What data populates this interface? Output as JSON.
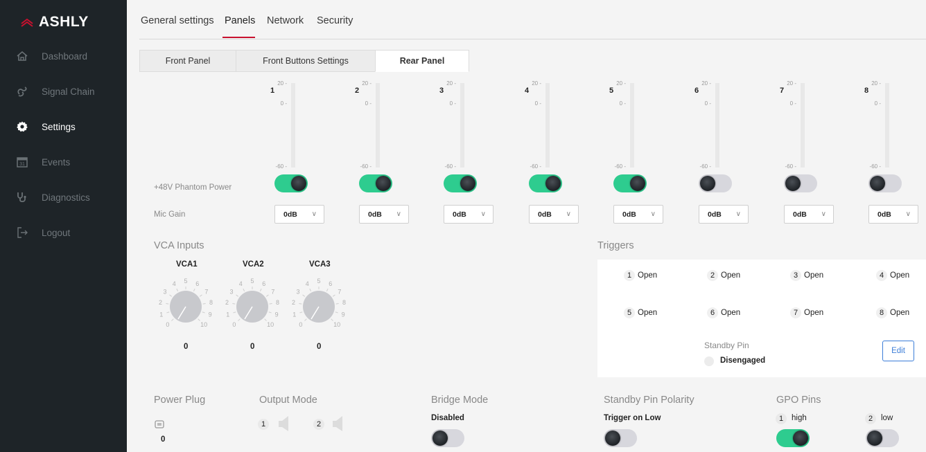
{
  "brand": {
    "name": "ASHLY"
  },
  "sidebar": {
    "items": [
      {
        "label": "Dashboard",
        "icon": "home-icon"
      },
      {
        "label": "Signal Chain",
        "icon": "signal-chain-icon"
      },
      {
        "label": "Settings",
        "icon": "gear-icon",
        "active": true
      },
      {
        "label": "Events",
        "icon": "calendar-icon"
      },
      {
        "label": "Diagnostics",
        "icon": "stethoscope-icon"
      },
      {
        "label": "Logout",
        "icon": "logout-icon"
      }
    ]
  },
  "top_tabs": [
    "General settings",
    "Panels",
    "Network",
    "Security"
  ],
  "active_top_tab": "Panels",
  "sub_tabs": [
    "Front Panel",
    "Front Buttons Settings",
    "Rear Panel"
  ],
  "active_sub_tab": "Rear Panel",
  "meter_ticks": [
    "20 -",
    "0 -",
    "-60 -"
  ],
  "channels": [
    {
      "num": "1",
      "phantom": true,
      "gain": "0dB"
    },
    {
      "num": "2",
      "phantom": true,
      "gain": "0dB"
    },
    {
      "num": "3",
      "phantom": true,
      "gain": "0dB"
    },
    {
      "num": "4",
      "phantom": true,
      "gain": "0dB"
    },
    {
      "num": "5",
      "phantom": true,
      "gain": "0dB"
    },
    {
      "num": "6",
      "phantom": false,
      "gain": "0dB"
    },
    {
      "num": "7",
      "phantom": false,
      "gain": "0dB"
    },
    {
      "num": "8",
      "phantom": false,
      "gain": "0dB"
    }
  ],
  "labels": {
    "phantom": "+48V Phantom Power",
    "mic_gain": "Mic Gain",
    "vca_inputs": "VCA Inputs",
    "triggers": "Triggers",
    "standby_pin": "Standby Pin",
    "standby_state": "Disengaged",
    "edit": "Edit",
    "power_plug": "Power Plug",
    "output_mode": "Output Mode",
    "bridge_mode": "Bridge Mode",
    "standby_polarity": "Standby Pin Polarity",
    "gpo_pins": "GPO Pins"
  },
  "vca": [
    {
      "label": "VCA1",
      "value": "0"
    },
    {
      "label": "VCA2",
      "value": "0"
    },
    {
      "label": "VCA3",
      "value": "0"
    }
  ],
  "knob_scale": [
    "0",
    "1",
    "2",
    "3",
    "4",
    "5",
    "6",
    "7",
    "8",
    "9",
    "10"
  ],
  "triggers": [
    {
      "num": "1",
      "state": "Open"
    },
    {
      "num": "2",
      "state": "Open"
    },
    {
      "num": "3",
      "state": "Open"
    },
    {
      "num": "4",
      "state": "Open"
    },
    {
      "num": "5",
      "state": "Open"
    },
    {
      "num": "6",
      "state": "Open"
    },
    {
      "num": "7",
      "state": "Open"
    },
    {
      "num": "8",
      "state": "Open"
    }
  ],
  "power_plug": {
    "value": "0"
  },
  "output_mode": [
    {
      "num": "1"
    },
    {
      "num": "2"
    }
  ],
  "bridge_mode": {
    "value": "Disabled",
    "on": false
  },
  "standby_polarity": {
    "value": "Trigger on Low",
    "on": false
  },
  "gpo": [
    {
      "num": "1",
      "value": "high",
      "on": true
    },
    {
      "num": "2",
      "value": "low",
      "on": false
    }
  ],
  "colors": {
    "accent": "#c8102e",
    "toggle_on": "#2ecc8f",
    "sidebar": "#1e2428",
    "link": "#3b7dd8"
  }
}
